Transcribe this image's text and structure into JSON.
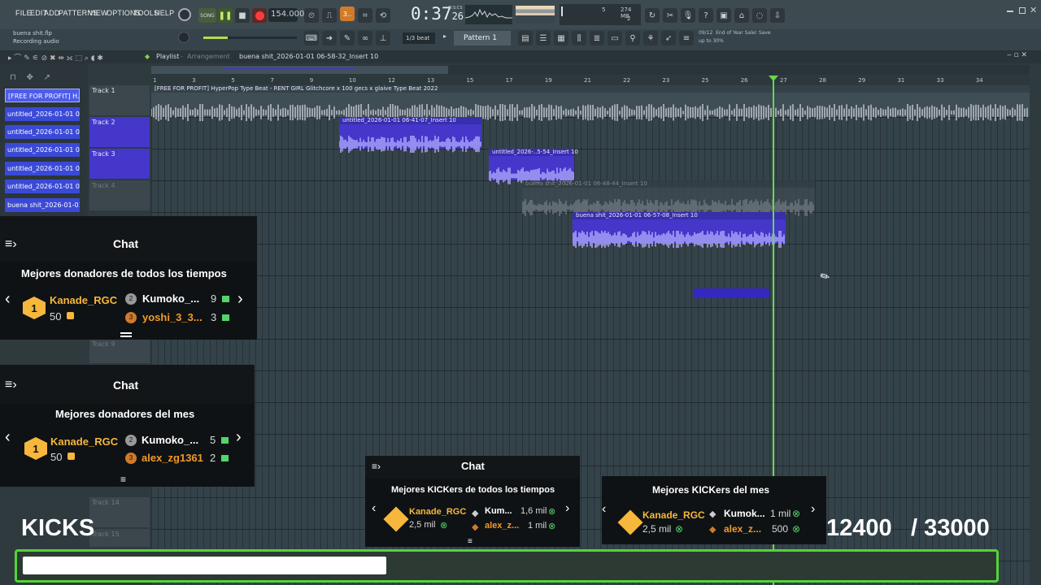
{
  "app": {
    "menus": [
      "FILE",
      "EDIT",
      "ADD",
      "PATTERNS",
      "VIEW",
      "OPTIONS",
      "TOOLS",
      "HELP"
    ],
    "mode_label": "SONG",
    "tempo": "154.000",
    "time_display": "0:37",
    "time_sub": "26",
    "time_unit": "M:S:CS",
    "cpu_count": "5",
    "mem": "274 MB",
    "mem_sub": "2",
    "snap": "1/3 beat",
    "pattern": "Pattern 1",
    "hint_line1": "buena shit.flp",
    "hint_line2": "Recording audio",
    "news_date": "09/12",
    "news_text1": "End of Year Sale! Save",
    "news_text2": "up to 30%"
  },
  "playlist": {
    "title": "Playlist",
    "subtitle": "Arrangement",
    "current_clip": "buena shit_2026-01-01 06-58-32_Insert 10",
    "ruler": [
      "1",
      "3",
      "5",
      "7",
      "9",
      "10",
      "12",
      "13",
      "15",
      "17",
      "19",
      "21",
      "22",
      "23",
      "25",
      "26",
      "27",
      "28",
      "29",
      "31",
      "33",
      "34"
    ],
    "picker_items": [
      "[FREE FOR PROFIT] H...",
      "untitled_2026-01-01 06-...",
      "untitled_2026-01-01 06-...",
      "untitled_2026-01-01 06-...",
      "untitled_2026-01-01 06-...",
      "untitled_2026-01-01 06-...",
      "buena shit_2026-01-01..."
    ],
    "tracks": [
      "Track 1",
      "Track 2",
      "Track 3",
      "Track 4",
      "Track 9",
      "Track 14",
      "Track 15"
    ],
    "clips": {
      "c1": "[FREE FOR PROFIT] HyperPop Type Beat - RENT GIRL  Glitchcore x 100 gecs x glaive Type Beat 2022",
      "c2": "untitled_2026-01-01 06-41-07_Insert 10",
      "c3": "untitled_2026-..5-54_Insert 10",
      "c4": "buena shit_2026-01-01 06-48-44_Insert 10",
      "c5": "buena shit_2026-01-01 06-57-08_Insert 10"
    }
  },
  "overlays": {
    "chat_label": "Chat",
    "alltime_donors": {
      "heading": "Mejores donadores de todos los tiempos",
      "first_name": "Kanade_RGC",
      "first_value": "50",
      "second_name": "Kumoko_...",
      "second_value": "9",
      "third_name": "yoshi_3_3...",
      "third_value": "3"
    },
    "month_donors": {
      "heading": "Mejores donadores del mes",
      "first_name": "Kanade_RGC",
      "first_value": "50",
      "second_name": "Kumoko_...",
      "second_value": "5",
      "third_name": "alex_zg1361",
      "third_value": "2"
    },
    "kickers_alltime": {
      "heading": "Mejores KICKers de todos los tiempos",
      "first_name": "Kanade_RGC",
      "first_value": "2,5 mil",
      "second_name": "Kum...",
      "second_value": "1,6 mil",
      "third_name": "alex_z...",
      "third_value": "1 mil"
    },
    "kickers_month": {
      "heading": "Mejores KICKers del mes",
      "first_name": "Kanade_RGC",
      "first_value": "2,5 mil",
      "second_name": "Kumok...",
      "second_value": "1 mil",
      "third_name": "alex_z...",
      "third_value": "500"
    },
    "kicks_label": "KICKS",
    "kicks_current": "12400",
    "kicks_goal": "/ 33000",
    "kicks_progress": 0.3758
  },
  "colors": {
    "accent_green": "#53d337",
    "clip_blue": "#4437c9",
    "gold": "#f6b73c"
  }
}
